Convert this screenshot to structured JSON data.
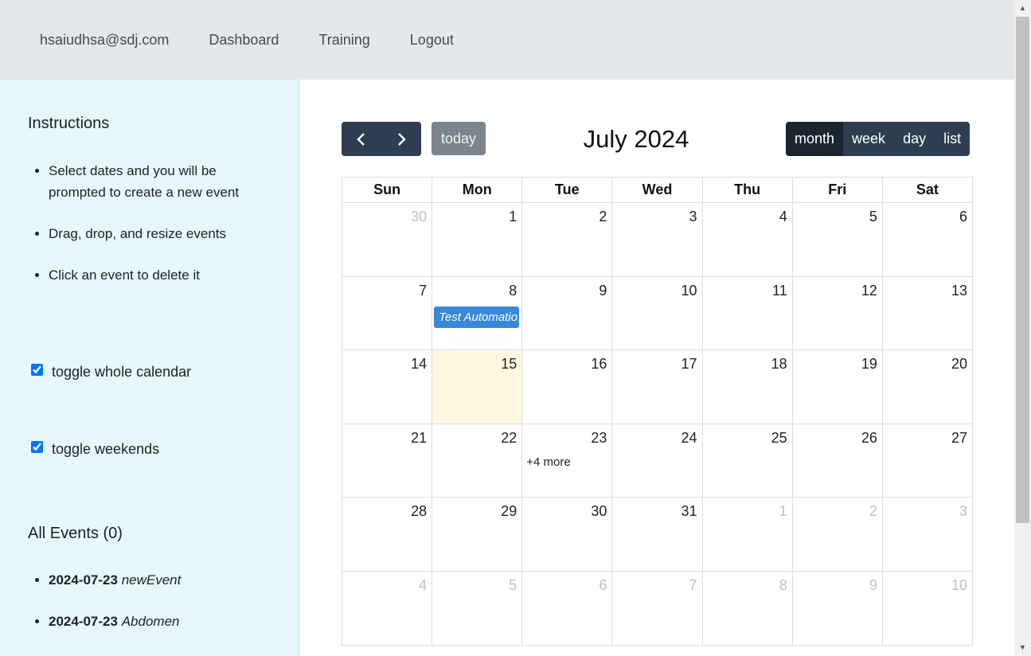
{
  "nav": {
    "user": "hsaiudhsa@sdj.com",
    "dashboard": "Dashboard",
    "training": "Training",
    "logout": "Logout"
  },
  "sidebar": {
    "instructions_title": "Instructions",
    "instructions": [
      "Select dates and you will be prompted to create a new event",
      "Drag, drop, and resize events",
      "Click an event to delete it"
    ],
    "toggle_calendar_label": "toggle whole calendar",
    "toggle_weekends_label": "toggle weekends",
    "all_events_title": "All Events (0)",
    "events": [
      {
        "date": "2024-07-23",
        "name": "newEvent"
      },
      {
        "date": "2024-07-23",
        "name": "Abdomen"
      }
    ]
  },
  "calendar": {
    "prev_icon": "chevron-left-icon",
    "next_icon": "chevron-right-icon",
    "today_label": "today",
    "title": "July 2024",
    "views": [
      "month",
      "week",
      "day",
      "list"
    ],
    "active_view": "month",
    "weekdays": [
      "Sun",
      "Mon",
      "Tue",
      "Wed",
      "Thu",
      "Fri",
      "Sat"
    ],
    "weeks": [
      [
        "30",
        "1",
        "2",
        "3",
        "4",
        "5",
        "6"
      ],
      [
        "7",
        "8",
        "9",
        "10",
        "11",
        "12",
        "13"
      ],
      [
        "14",
        "15",
        "16",
        "17",
        "18",
        "19",
        "20"
      ],
      [
        "21",
        "22",
        "23",
        "24",
        "25",
        "26",
        "27"
      ],
      [
        "28",
        "29",
        "30",
        "31",
        "1",
        "2",
        "3"
      ],
      [
        "4",
        "5",
        "6",
        "7",
        "8",
        "9",
        "10"
      ]
    ],
    "event_chip": "Test Automation",
    "more_link": "+4 more"
  },
  "colors": {
    "nav_bg": "#e5e8ea",
    "sidebar_bg": "#e8f7fd",
    "button": "#2c3e50",
    "button_active": "#1a252f",
    "event": "#3788d8",
    "today_highlight": "#fff8e1"
  }
}
